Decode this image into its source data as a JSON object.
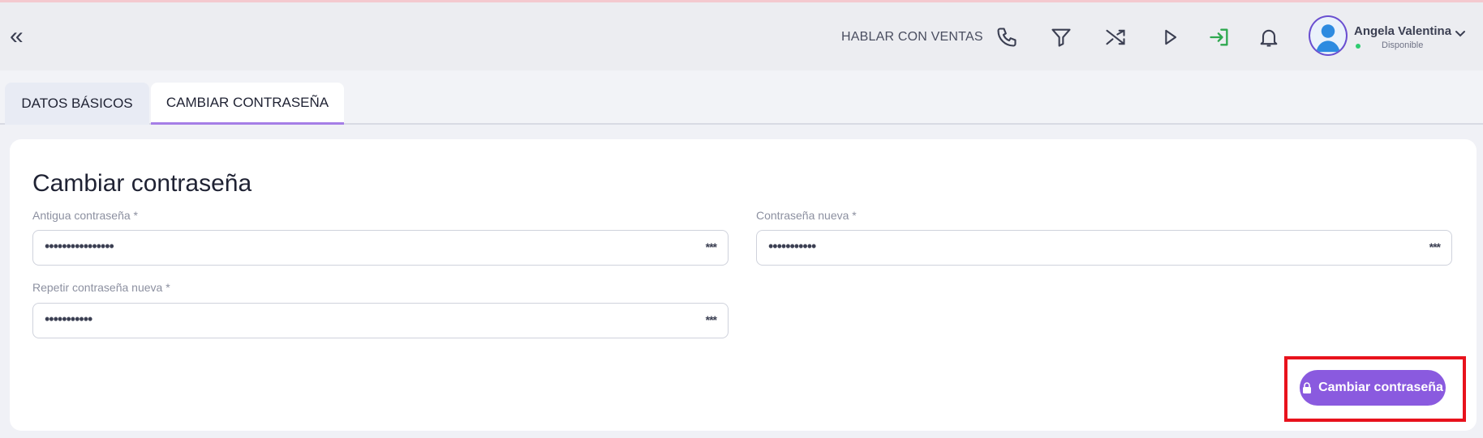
{
  "header": {
    "collapse_glyph": "«",
    "sales_label": "HABLAR CON VENTAS",
    "icons": [
      "phone-icon",
      "filter-icon",
      "shuffle-icon",
      "play-icon",
      "login-icon",
      "bell-icon"
    ],
    "user": {
      "name": "Angela Valentina",
      "status": "Disponible",
      "status_color": "#2ecc71"
    }
  },
  "tabs": [
    {
      "label": "DATOS BÁSICOS",
      "active": false
    },
    {
      "label": "CAMBIAR CONTRASEÑA",
      "active": true
    }
  ],
  "form": {
    "title": "Cambiar contraseña",
    "fields": [
      {
        "label": "Antigua contraseña *",
        "value": "••••••••••••••••"
      },
      {
        "label": "Contraseña nueva *",
        "value": "•••••••••••"
      },
      {
        "label": "Repetir contraseña nueva *",
        "value": "•••••••••••"
      }
    ],
    "toggle_glyph": "***",
    "submit_label": "Cambiar contraseña"
  },
  "colors": {
    "accent": "#8a5adf",
    "tab_underline": "#a57ee6",
    "highlight": "#e8121c"
  }
}
